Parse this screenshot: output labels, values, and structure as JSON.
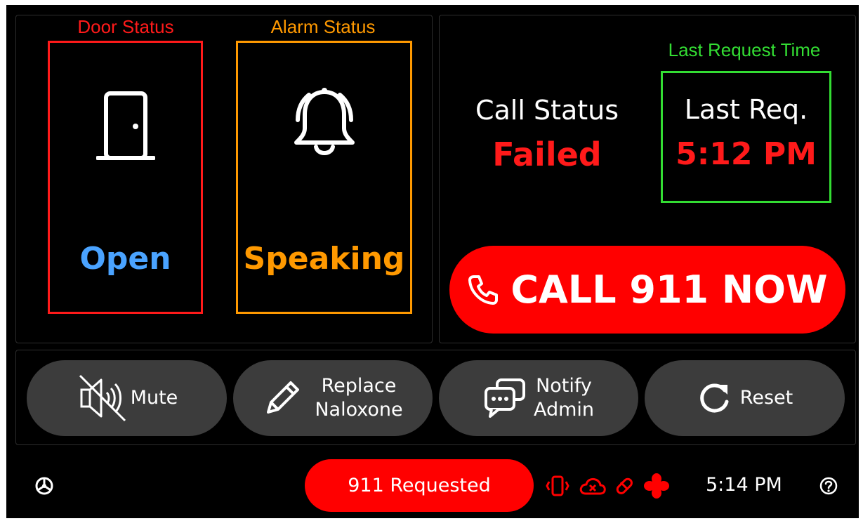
{
  "door": {
    "title": "Door Status",
    "value": "Open",
    "icon": "door-icon",
    "colors": {
      "title": "#ff1a1a",
      "border": "#ff1a1a",
      "value": "#4aa3ff"
    }
  },
  "alarm": {
    "title": "Alarm Status",
    "value": "Speaking",
    "icon": "bell-ringing-icon",
    "colors": {
      "title": "#ff9900",
      "border": "#ff9900",
      "value": "#ff9900"
    }
  },
  "call_status": {
    "label": "Call Status",
    "value": "Failed",
    "value_color": "#ff1a1a"
  },
  "last_request": {
    "title": "Last Request Time",
    "label": "Last Req.",
    "value": "5:12 PM",
    "colors": {
      "title": "#33dd33",
      "border": "#33dd33",
      "value": "#ff1a1a"
    }
  },
  "call_button": {
    "label": "CALL 911 NOW",
    "icon": "phone-icon",
    "color": "#ff0000"
  },
  "actions": [
    {
      "label": "Mute",
      "icon": "speaker-muted-icon"
    },
    {
      "label": "Replace\nNaloxone",
      "icon": "pencil-icon"
    },
    {
      "label": "Notify\nAdmin",
      "icon": "chat-bubbles-icon"
    },
    {
      "label": "Reset",
      "icon": "refresh-icon"
    }
  ],
  "status_bar": {
    "pill_label": "911 Requested",
    "time": "5:14 PM",
    "icons": [
      "settings-icon",
      "vibrate-icon",
      "cloud-error-icon",
      "pill-icon",
      "fan-icon",
      "help-icon"
    ],
    "alert_color": "#ff0000"
  }
}
